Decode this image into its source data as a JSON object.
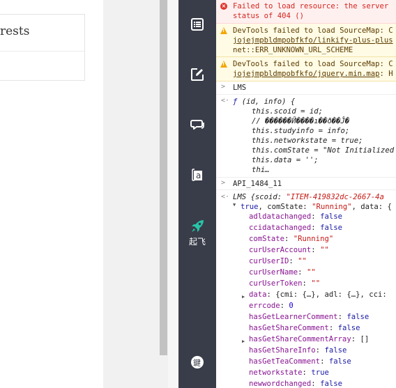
{
  "left_page": {
    "interests_title": "rests"
  },
  "sidebar": {
    "items": [
      {
        "icon": "list-icon"
      },
      {
        "icon": "edit-icon"
      },
      {
        "icon": "chat-icon"
      },
      {
        "icon": "text-a-icon",
        "glyph": "a"
      },
      {
        "icon": "rocket-icon",
        "label": "起飞"
      },
      {
        "icon": "keyboard-icon",
        "glyph": "鍵"
      }
    ],
    "accent_color": "#27c4a8"
  },
  "console": {
    "error": {
      "line1": "Failed to load resource: the server",
      "line2": "status of 404 ()"
    },
    "warn1": {
      "line1": "DevTools failed to load SourceMap: C",
      "line2": "jojejmpbldmpobfkfo/linkify-plus-plus",
      "line3": "net::ERR_UNKNOWN_URL_SCHEME"
    },
    "warn2": {
      "line1": "DevTools failed to load SourceMap: C",
      "line2": "jojejmpbldmpobfkfo/jquery.min.map",
      "line2_suffix": ": H"
    },
    "input1": "LMS",
    "func": {
      "sig_keyword": "ƒ",
      "sig": " (id, info) {",
      "lines": [
        "this.scoid = id;",
        "// ������Ӣ����ı��ð��Ĵ�",
        "this.studyinfo = info;",
        "this.networkstate = true;",
        "this.comState = \"Not Initialized",
        "this.data = '';",
        "thi…"
      ]
    },
    "input2": "API_1484_11",
    "object": {
      "header_class": "LMS {scoid: ",
      "header_scoid": "\"ITEM-419832dc-2667-4a",
      "header2_true": "true",
      "header2_rest": ", comState: ",
      "header2_running": "\"Running\"",
      "header2_tail": ", data: {",
      "props": [
        {
          "key": "adldatachanged",
          "value": "false",
          "type": "kw"
        },
        {
          "key": "ccidatachanged",
          "value": "false",
          "type": "kw"
        },
        {
          "key": "comState",
          "value": "\"Running\"",
          "type": "str"
        },
        {
          "key": "curUserAccount",
          "value": "\"\"",
          "type": "str"
        },
        {
          "key": "curUserID",
          "value": "\"\"",
          "type": "str"
        },
        {
          "key": "curUserName",
          "value": "\"\"",
          "type": "str"
        },
        {
          "key": "curUserToken",
          "value": "\"\"",
          "type": "str"
        },
        {
          "key": "data",
          "value": "{cmi: {…}, adl: {…}, cci:",
          "type": "obj",
          "expandable": true
        },
        {
          "key": "errcode",
          "value": "0",
          "type": "num"
        },
        {
          "key": "hasGetLearnerComment",
          "value": "false",
          "type": "kw"
        },
        {
          "key": "hasGetShareComment",
          "value": "false",
          "type": "kw"
        },
        {
          "key": "hasGetShareCommentArray",
          "value": "[]",
          "type": "obj",
          "expandable": true
        },
        {
          "key": "hasGetShareInfo",
          "value": "false",
          "type": "kw"
        },
        {
          "key": "hasGetTeaComment",
          "value": "false",
          "type": "kw"
        },
        {
          "key": "networkstate",
          "value": "true",
          "type": "kw"
        },
        {
          "key": "newwordchanged",
          "value": "false",
          "type": "kw"
        }
      ]
    }
  }
}
